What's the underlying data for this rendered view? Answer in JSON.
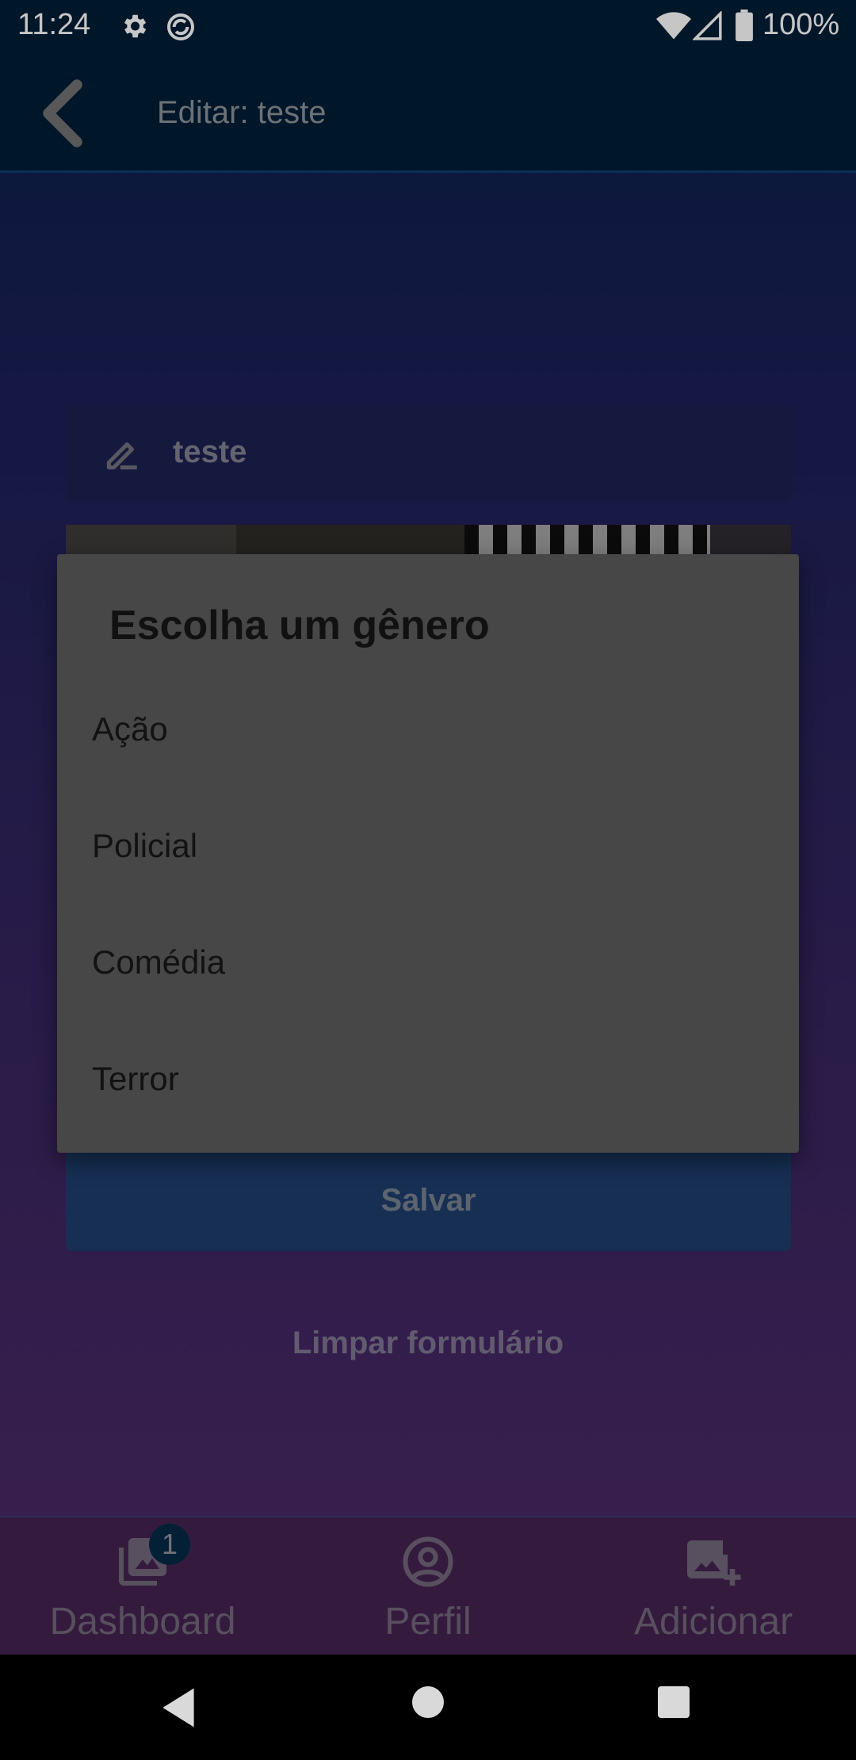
{
  "status_bar": {
    "time": "11:24",
    "battery": "100%",
    "icons": [
      "gear-icon",
      "sync-icon",
      "wifi-icon",
      "signal-icon",
      "battery-icon"
    ]
  },
  "app_bar": {
    "title": "Editar: teste",
    "back_icon": "chevron-left-icon"
  },
  "form": {
    "name_value": "teste",
    "name_icon": "pencil-icon",
    "save_label": "Salvar",
    "clear_label": "Limpar formulário"
  },
  "dialog": {
    "title": "Escolha um gênero",
    "options": [
      "Ação",
      "Policial",
      "Comédia",
      "Terror"
    ]
  },
  "bottom_nav": {
    "items": [
      {
        "label": "Dashboard",
        "icon": "photo-library-icon",
        "badge": "1"
      },
      {
        "label": "Perfil",
        "icon": "account-circle-icon"
      },
      {
        "label": "Adicionar",
        "icon": "add-photo-icon"
      }
    ]
  },
  "colors": {
    "app_bar_bg": "#011b33",
    "dialog_bg": "#474747",
    "save_button_bg": "#1c3a66",
    "gradient_top": "#0a1f45",
    "gradient_bottom": "#4a2660"
  }
}
